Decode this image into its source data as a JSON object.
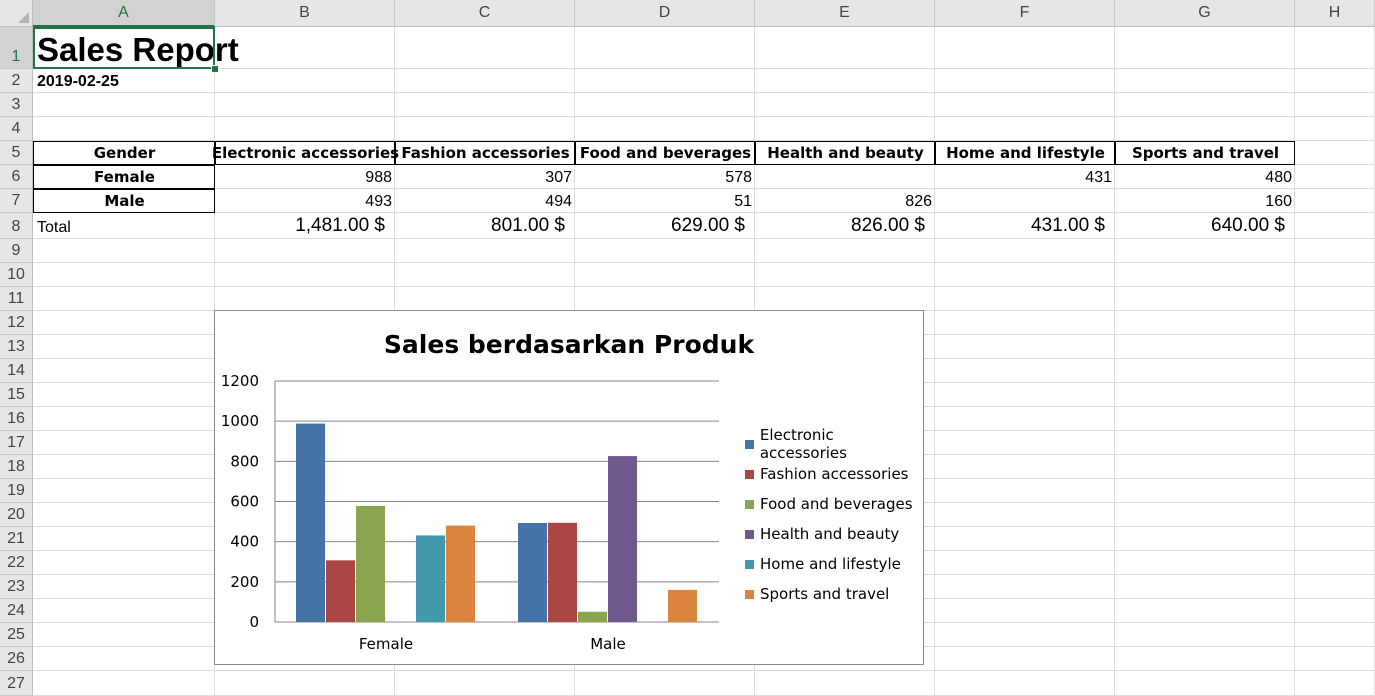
{
  "sheet": {
    "columns": [
      "A",
      "B",
      "C",
      "D",
      "E",
      "F",
      "G",
      "H"
    ],
    "rows": [
      "1",
      "2",
      "3",
      "4",
      "5",
      "6",
      "7",
      "8",
      "9",
      "10",
      "11",
      "12",
      "13",
      "14",
      "15",
      "16",
      "17",
      "18",
      "19",
      "20",
      "21",
      "22",
      "23",
      "24",
      "25",
      "26",
      "27"
    ],
    "title": "Sales Report",
    "date": "2019-02-25",
    "table": {
      "header_label": "Gender",
      "categories": [
        "Electronic accessories",
        "Fashion accessories",
        "Food and beverages",
        "Health and beauty",
        "Home and lifestyle",
        "Sports and travel"
      ],
      "rows": [
        {
          "label": "Female",
          "values": [
            "988",
            "307",
            "578",
            "",
            "431",
            "480"
          ]
        },
        {
          "label": "Male",
          "values": [
            "493",
            "494",
            "51",
            "826",
            "",
            "160"
          ]
        }
      ],
      "total_label": "Total",
      "totals": [
        "1,481.00 $",
        "801.00 $",
        "629.00 $",
        "826.00 $",
        "431.00 $",
        "640.00 $"
      ]
    }
  },
  "chart_data": {
    "type": "bar",
    "title": "Sales berdasarkan Produk",
    "categories": [
      "Female",
      "Male"
    ],
    "series": [
      {
        "name": "Electronic accessories",
        "values": [
          988,
          493
        ],
        "color": "#4572a7"
      },
      {
        "name": "Fashion accessories",
        "values": [
          307,
          494
        ],
        "color": "#aa4643"
      },
      {
        "name": "Food and beverages",
        "values": [
          578,
          51
        ],
        "color": "#89a54e"
      },
      {
        "name": "Health and beauty",
        "values": [
          0,
          826
        ],
        "color": "#71588f"
      },
      {
        "name": "Home and lifestyle",
        "values": [
          431,
          0
        ],
        "color": "#4198af"
      },
      {
        "name": "Sports and travel",
        "values": [
          480,
          160
        ],
        "color": "#db843d"
      }
    ],
    "ylim": [
      0,
      1200
    ],
    "yticks": [
      "0",
      "200",
      "400",
      "600",
      "800",
      "1000",
      "1200"
    ],
    "grid": true,
    "legend": "right"
  }
}
